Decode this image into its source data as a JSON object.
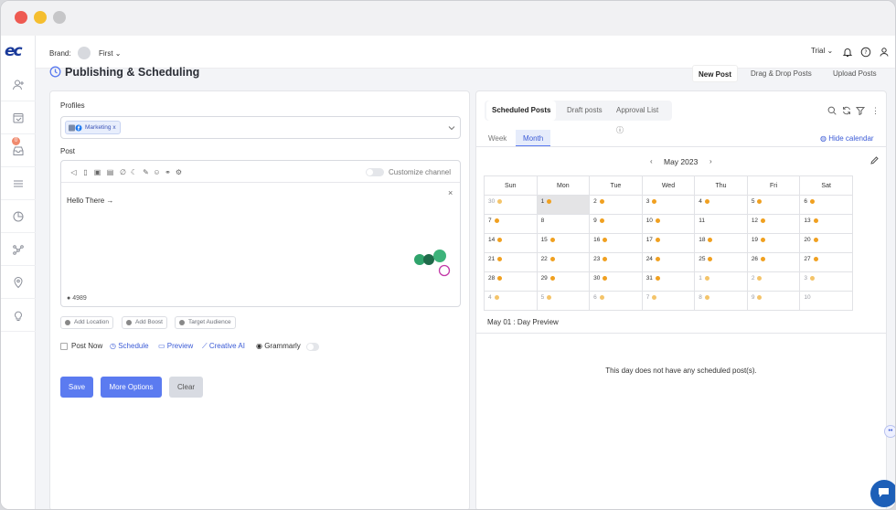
{
  "app": {
    "brand_label": "Brand:",
    "brand_name": "First",
    "plan": "Trial",
    "logo_text": "ec"
  },
  "sidebar": {
    "inbox_badge": "0",
    "icons": [
      "add-user-icon",
      "calendar-icon",
      "inbox-icon",
      "menu-lines-icon",
      "pie-chart-icon",
      "network-icon",
      "location-pin-icon",
      "lightbulb-icon"
    ]
  },
  "header": {
    "title": "Publishing & Scheduling",
    "tabs": [
      "New Post",
      "Drag & Drop Posts",
      "Upload Posts"
    ]
  },
  "compose": {
    "profiles_label": "Profiles",
    "profile_chip": "Marketing x",
    "post_label": "Post",
    "customize_channel": "Customize channel",
    "post_text": "Hello There →",
    "char_count": "4989",
    "meta_buttons": [
      "Add Location",
      "Add Boost",
      "Target Audience"
    ],
    "options": {
      "post_now": "Post Now",
      "schedule": "Schedule",
      "preview": "Preview",
      "creative_ai": "Creative AI",
      "grammarly": "Grammarly"
    },
    "buttons": {
      "save": "Save",
      "more": "More Options",
      "clear": "Clear"
    }
  },
  "calendar": {
    "tabs": [
      "Scheduled Posts",
      "Draft posts",
      "Approval List ⓘ"
    ],
    "views": [
      "Week",
      "Month"
    ],
    "hide_calendar": "Hide calendar",
    "month": "May 2023",
    "weekdays": [
      "Sun",
      "Mon",
      "Tue",
      "Wed",
      "Thu",
      "Fri",
      "Sat"
    ],
    "weeks": [
      [
        {
          "d": "30",
          "e": "light",
          "m": true
        },
        {
          "d": "1",
          "e": "dark",
          "m": false,
          "sel": true
        },
        {
          "d": "2",
          "e": "dark"
        },
        {
          "d": "3",
          "e": "dark"
        },
        {
          "d": "4",
          "e": "dark"
        },
        {
          "d": "5",
          "e": "dark"
        },
        {
          "d": "6",
          "e": "dark"
        }
      ],
      [
        {
          "d": "7",
          "e": "dark"
        },
        {
          "d": "8",
          "e": ""
        },
        {
          "d": "9",
          "e": "dark"
        },
        {
          "d": "10",
          "e": "dark"
        },
        {
          "d": "11",
          "e": ""
        },
        {
          "d": "12",
          "e": "dark"
        },
        {
          "d": "13",
          "e": "dark"
        }
      ],
      [
        {
          "d": "14",
          "e": "dark"
        },
        {
          "d": "15",
          "e": "dark"
        },
        {
          "d": "16",
          "e": "dark"
        },
        {
          "d": "17",
          "e": "dark"
        },
        {
          "d": "18",
          "e": "dark"
        },
        {
          "d": "19",
          "e": "dark"
        },
        {
          "d": "20",
          "e": "dark"
        }
      ],
      [
        {
          "d": "21",
          "e": "dark"
        },
        {
          "d": "22",
          "e": "dark"
        },
        {
          "d": "23",
          "e": "dark"
        },
        {
          "d": "24",
          "e": "dark"
        },
        {
          "d": "25",
          "e": "dark"
        },
        {
          "d": "26",
          "e": "dark"
        },
        {
          "d": "27",
          "e": "dark"
        }
      ],
      [
        {
          "d": "28",
          "e": "dark"
        },
        {
          "d": "29",
          "e": "dark"
        },
        {
          "d": "30",
          "e": "dark"
        },
        {
          "d": "31",
          "e": "dark"
        },
        {
          "d": "1",
          "e": "light",
          "m": true
        },
        {
          "d": "2",
          "e": "light",
          "m": true
        },
        {
          "d": "3",
          "e": "light",
          "m": true
        }
      ],
      [
        {
          "d": "4",
          "e": "light",
          "m": true
        },
        {
          "d": "5",
          "e": "light",
          "m": true
        },
        {
          "d": "6",
          "e": "light",
          "m": true
        },
        {
          "d": "7",
          "e": "light",
          "m": true
        },
        {
          "d": "8",
          "e": "light",
          "m": true
        },
        {
          "d": "9",
          "e": "light",
          "m": true
        },
        {
          "d": "10",
          "e": "",
          "m": true
        }
      ]
    ],
    "day_preview_title": "May 01 : Day Preview",
    "empty_message": "This day does not have any scheduled post(s)."
  },
  "colors": {
    "primary": "#5b7bf0",
    "event_dark": "#f0a020",
    "event_light": "#f4c46a",
    "chat": "#1d5fb8"
  }
}
